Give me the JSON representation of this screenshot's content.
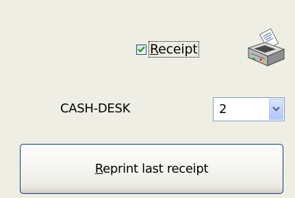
{
  "receipt": {
    "label_accel": "R",
    "label_rest": "eceipt",
    "checked": true,
    "check_color": "#21a121"
  },
  "printer": {
    "icon": "printer-icon"
  },
  "cash_desk": {
    "label": "CASH-DESK",
    "selected": "2",
    "arrow_icon": "chevron-down-icon"
  },
  "reprint_button": {
    "label_accel": "R",
    "label_rest": "eprint last receipt"
  },
  "colors": {
    "background": "#efeee4",
    "button_border": "#003c74",
    "select_border": "#7f9db9"
  }
}
